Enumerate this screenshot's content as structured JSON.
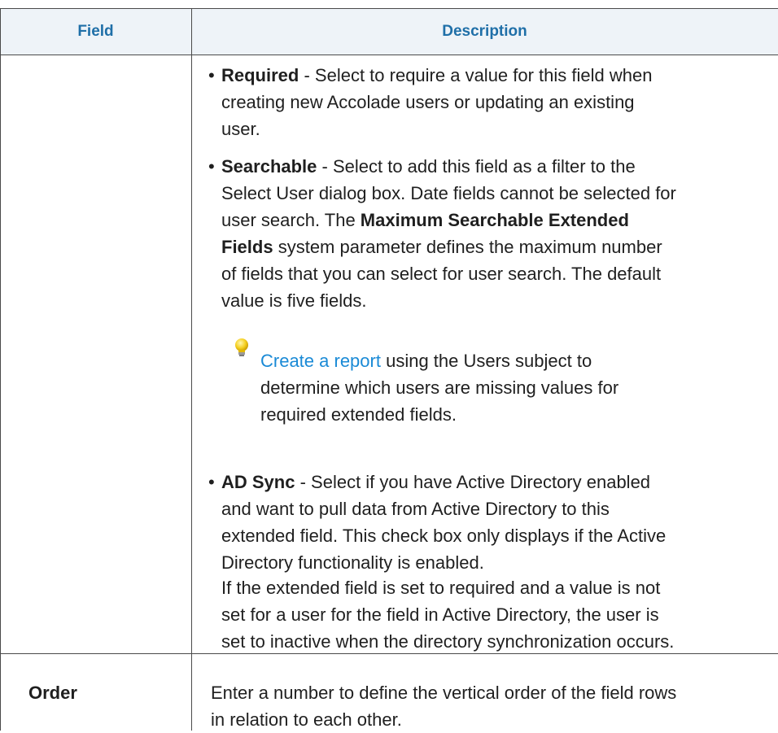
{
  "table": {
    "headers": {
      "field": "Field",
      "description": "Description"
    },
    "bullets": [
      {
        "term": "Required",
        "lines": [
          " - Select to require a value for this field when",
          "creating new Accolade users or updating an existing",
          "user."
        ]
      },
      {
        "term": "Searchable",
        "lines": [
          " - Select to add this field as a filter to the",
          "Select User dialog box. Date fields cannot be selected for",
          "user search. The ",
          "system parameter defines the maximum number",
          "of fields that you can select for user search. The default",
          "value is five fields."
        ],
        "bold_parts": [
          "Maximum Searchable Extended",
          "Fields"
        ]
      },
      {
        "term": "AD Sync",
        "lines": [
          " - Select if you have Active Directory enabled",
          "and want to pull data from Active Directory to this",
          "extended field. This check box only displays if the Active",
          "Directory functionality is enabled."
        ]
      }
    ],
    "tip": {
      "icon": "lightbulb-icon",
      "link_text": "Create a report",
      "lines": [
        " using the Users subject to",
        "determine which users are missing values for",
        "required extended fields."
      ]
    },
    "note_lines": [
      "If the extended field is set to required and a value is not",
      "set for a user for the field in Active Directory, the user is",
      "set to inactive when the directory synchronization occurs."
    ],
    "order_row": {
      "field": "Order",
      "description_lines": [
        "Enter a number to define the vertical order of the field rows",
        "in relation to each other."
      ]
    }
  },
  "colors": {
    "header_bg": "#eef3f8",
    "header_text": "#1f6fa8",
    "link": "#1a8ad6",
    "border": "#4a4a4a"
  }
}
